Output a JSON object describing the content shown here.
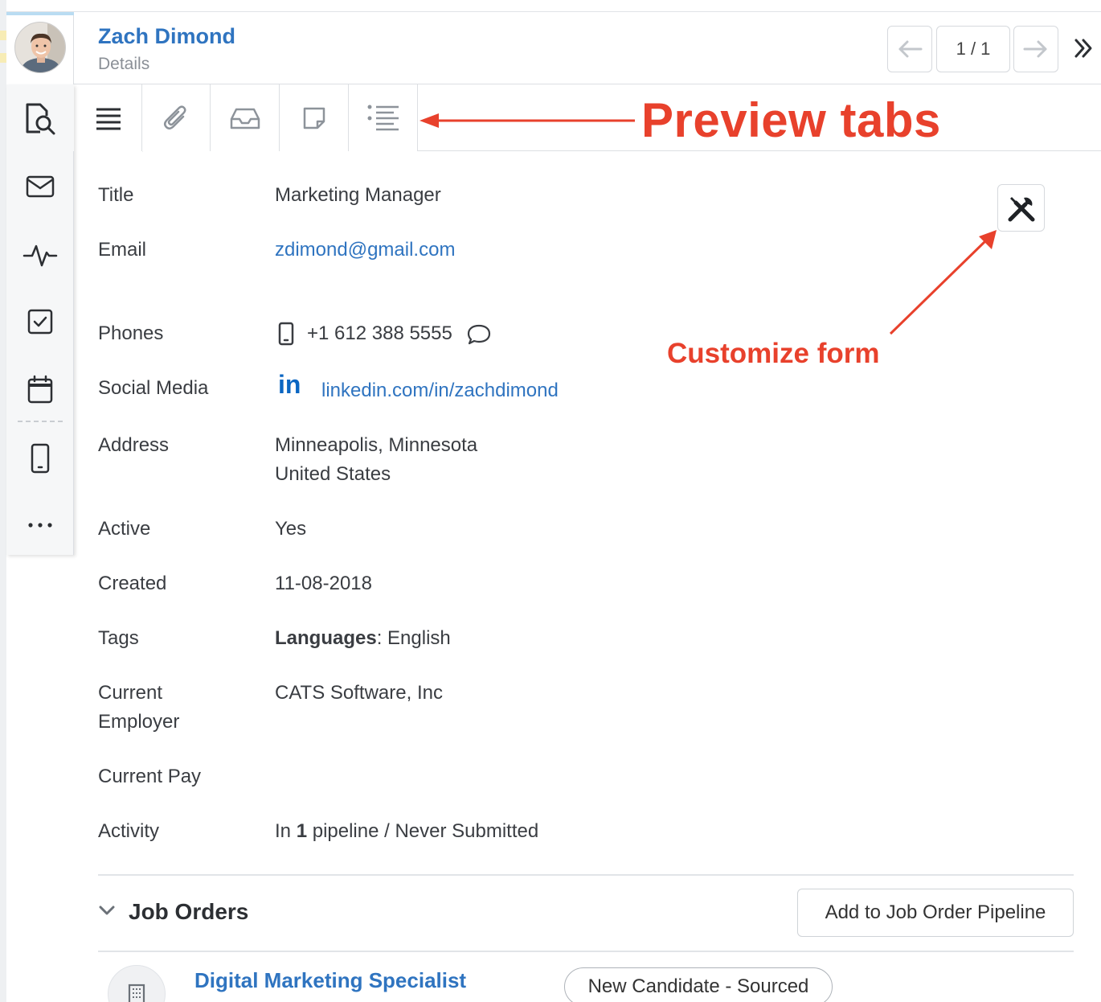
{
  "header": {
    "name": "Zach Dimond",
    "subtitle": "Details",
    "pagination": "1 / 1"
  },
  "form": {
    "title_label": "Title",
    "title_value": "Marketing Manager",
    "email_label": "Email",
    "email_value": "zdimond@gmail.com",
    "phones_label": "Phones",
    "phone_value": "+1 612 388 5555",
    "social_label": "Social Media",
    "social_icon_text": "in",
    "social_value": "linkedin.com/in/zachdimond",
    "address_label": "Address",
    "address_line1": "Minneapolis, Minnesota",
    "address_line2": "United States",
    "active_label": "Active",
    "active_value": "Yes",
    "created_label": "Created",
    "created_value": "11-08-2018",
    "tags_label": "Tags",
    "tags_key": "Languages",
    "tags_value": ": English",
    "employer_label_1": "Current",
    "employer_label_2": "Employer",
    "employer_value": "CATS Software, Inc",
    "pay_label": "Current Pay",
    "activity_label": "Activity",
    "activity_prefix": "In ",
    "activity_count": "1",
    "activity_suffix": " pipeline / Never Submitted"
  },
  "annotations": {
    "preview_tabs": "Preview tabs",
    "customize_form": "Customize form",
    "color": "#e8412c"
  },
  "job_orders": {
    "title": "Job Orders",
    "add_button": "Add to Job Order Pipeline",
    "items": [
      {
        "title": "Digital Marketing Specialist",
        "status": "New Candidate - Sourced"
      }
    ]
  },
  "colors": {
    "link": "#2f74c0",
    "text": "#3a3d42",
    "border": "#dcdfe3"
  },
  "icons": {
    "tabs": [
      "details-list-icon",
      "attachment-icon",
      "inbox-icon",
      "note-icon",
      "activity-list-icon"
    ],
    "sidebar": [
      "preview-search-icon",
      "email-icon",
      "pulse-icon",
      "checkbox-icon",
      "calendar-icon",
      "mobile-icon",
      "more-icon"
    ]
  }
}
